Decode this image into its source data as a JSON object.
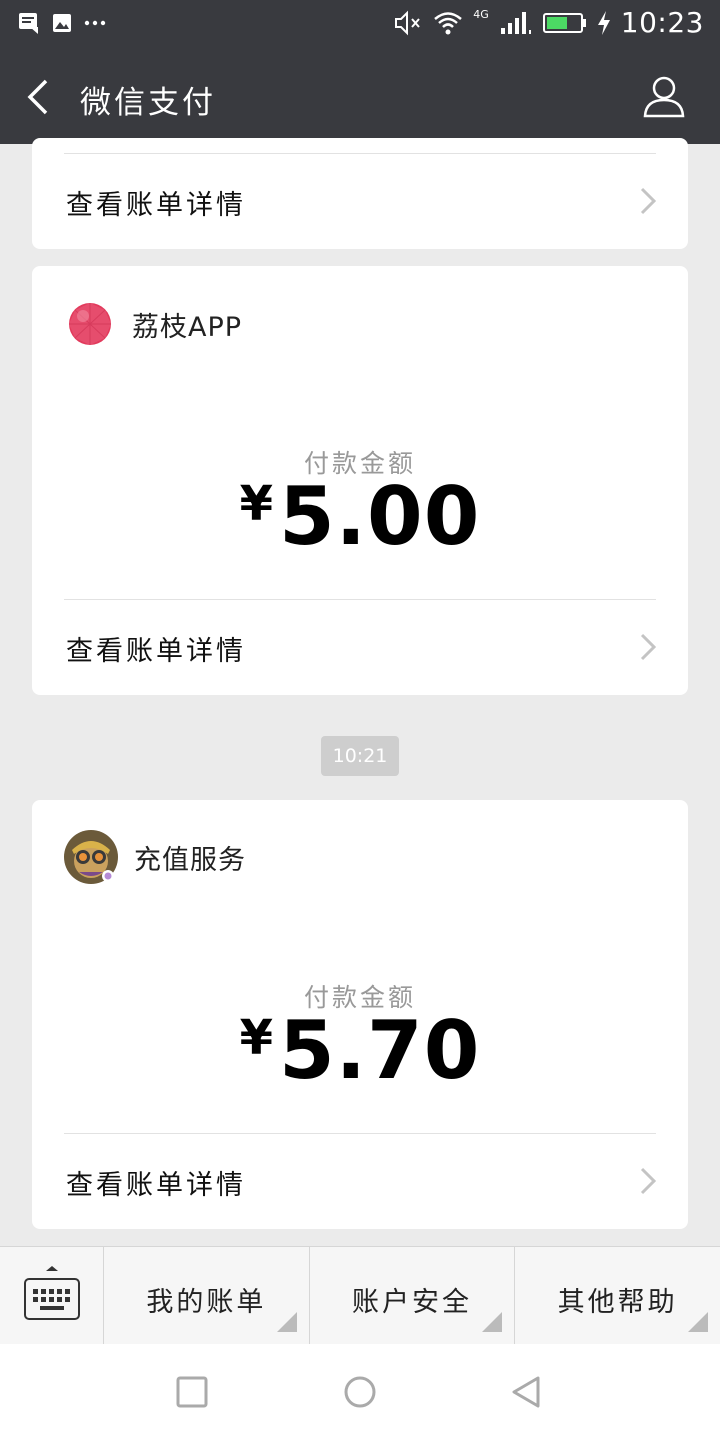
{
  "status_bar": {
    "time": "10:23",
    "network": "4G",
    "icons": [
      "message-icon",
      "image-icon",
      "more-dots-icon",
      "mute-icon",
      "wifi-icon",
      "signal-icon",
      "battery-icon",
      "charging-icon"
    ]
  },
  "header": {
    "title": "微信支付",
    "back_icon": "chevron-left-icon",
    "profile_icon": "person-icon"
  },
  "messages": [
    {
      "detail_label": "查看账单详情"
    },
    {
      "merchant_name": "荔枝APP",
      "amount_label": "付款金额",
      "currency": "¥",
      "amount": "5.00",
      "detail_label": "查看账单详情"
    },
    {
      "timestamp": "10:21",
      "merchant_name": "充值服务",
      "amount_label": "付款金额",
      "currency": "¥",
      "amount": "5.70",
      "detail_label": "查看账单详情"
    }
  ],
  "bottom_menu": {
    "keyboard_icon": "keyboard-icon",
    "items": [
      {
        "label": "我的账单"
      },
      {
        "label": "账户安全"
      },
      {
        "label": "其他帮助"
      }
    ]
  },
  "nav": {
    "icons": [
      "recents-square-icon",
      "home-circle-icon",
      "back-triangle-icon"
    ]
  },
  "colors": {
    "header_bg": "#393a3f",
    "page_bg": "#ebebeb",
    "card_bg": "#ffffff",
    "timestamp_bg": "#cecece",
    "brand_red": "#e23a5c"
  }
}
